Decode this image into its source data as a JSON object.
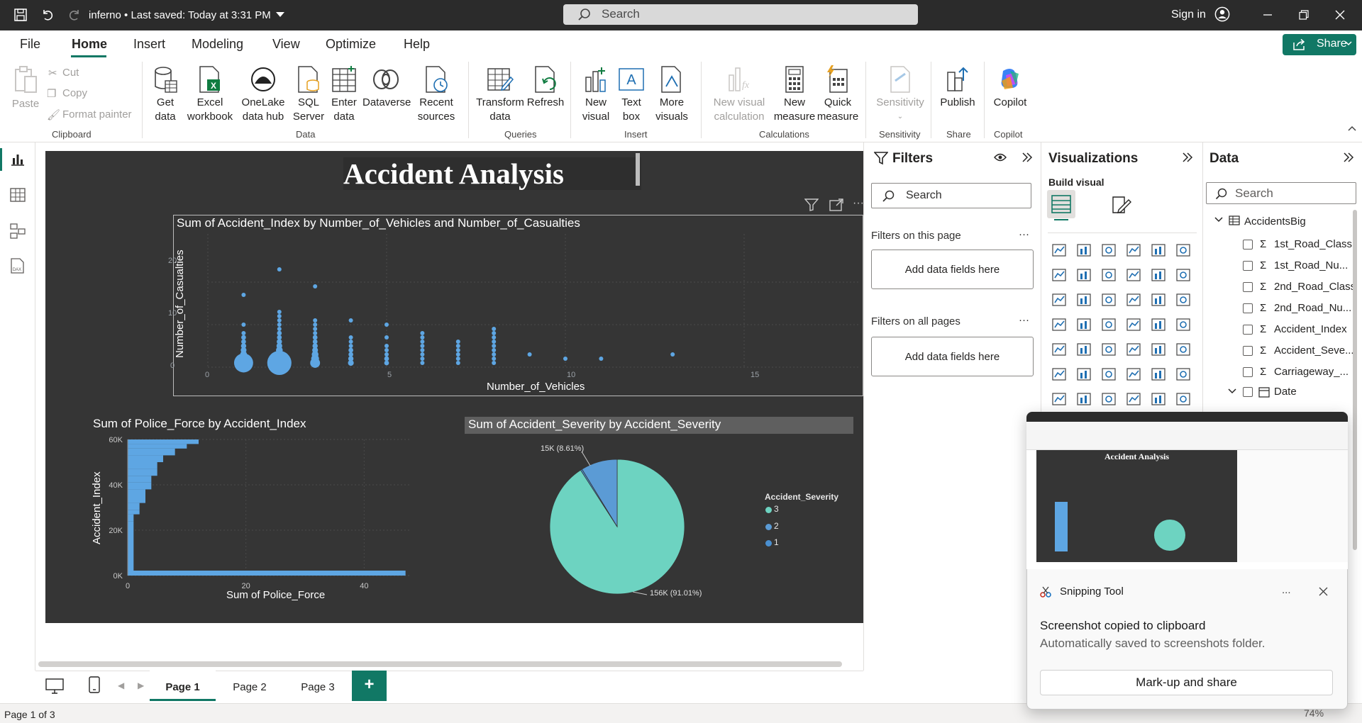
{
  "titlebar": {
    "file_title": "inferno • Last saved: Today at 3:31 PM",
    "search": "Search",
    "sign_in": "Sign in"
  },
  "menu": {
    "items": [
      "File",
      "Home",
      "Insert",
      "Modeling",
      "View",
      "Optimize",
      "Help"
    ],
    "share": "Share"
  },
  "ribbon": {
    "clipboard": {
      "paste": "Paste",
      "cut": "Cut",
      "copy": "Copy",
      "format_painter": "Format painter",
      "group": "Clipboard"
    },
    "data": {
      "get_data": [
        "Get",
        "data"
      ],
      "excel": [
        "Excel",
        "workbook"
      ],
      "onelake": [
        "OneLake",
        "data hub"
      ],
      "sql": [
        "SQL",
        "Server"
      ],
      "enter": [
        "Enter",
        "data"
      ],
      "dataverse": "Dataverse",
      "recent": [
        "Recent",
        "sources"
      ],
      "group": "Data"
    },
    "queries": {
      "transform": [
        "Transform",
        "data"
      ],
      "refresh": "Refresh",
      "group": "Queries"
    },
    "insert": {
      "new_visual": [
        "New",
        "visual"
      ],
      "text_box": [
        "Text",
        "box"
      ],
      "more_visuals": [
        "More",
        "visuals"
      ],
      "group": "Insert"
    },
    "calculations": {
      "new_visual_calc": [
        "New visual",
        "calculation"
      ],
      "new_measure": [
        "New",
        "measure"
      ],
      "quick_measure": [
        "Quick",
        "measure"
      ],
      "group": "Calculations"
    },
    "sensitivity": {
      "label": "Sensitivity",
      "group": "Sensitivity"
    },
    "share": {
      "publish": "Publish",
      "group": "Share"
    },
    "copilot": {
      "label": "Copilot",
      "group": "Copilot"
    }
  },
  "report": {
    "title": "Accident Analysis",
    "scatter": {
      "title": "Sum of Accident_Index by Number_of_Vehicles and Number_of_Casualties",
      "xlabel": "Number_of_Vehicles",
      "ylabel": "Number_of_Casualties",
      "xticks": [
        "0",
        "5",
        "10",
        "15"
      ],
      "yticks": [
        "20",
        "10",
        "0"
      ]
    },
    "bar": {
      "title": "Sum of Police_Force by Accident_Index",
      "xlabel": "Sum of Police_Force",
      "ylabel": "Accident_Index",
      "xticks": [
        "0",
        "20",
        "40"
      ],
      "yticks": [
        "60K",
        "40K",
        "20K",
        "0K"
      ]
    },
    "pie": {
      "title": "Sum of Accident_Severity by Accident_Severity",
      "legend_title": "Accident_Severity",
      "legend": [
        "3",
        "2",
        "1"
      ],
      "label_small": "15K (8.61%)",
      "label_big": "156K (91.01%)"
    }
  },
  "chart_data": [
    {
      "type": "scatter",
      "title": "Sum of Accident_Index by Number_of_Vehicles and Number_of_Casualties",
      "xlabel": "Number_of_Vehicles",
      "ylabel": "Number_of_Casualties",
      "xlim": [
        0,
        18
      ],
      "ylim": [
        0,
        23
      ],
      "points": [
        {
          "x": 1,
          "y": 1,
          "size": 3
        },
        {
          "x": 1,
          "y": 2,
          "size": 1
        },
        {
          "x": 1,
          "y": 3,
          "size": 0.6
        },
        {
          "x": 1,
          "y": 4,
          "size": 0.4
        },
        {
          "x": 1,
          "y": 5,
          "size": 0.3
        },
        {
          "x": 1,
          "y": 6,
          "size": 0.2
        },
        {
          "x": 1,
          "y": 7,
          "size": 0.2
        },
        {
          "x": 1,
          "y": 8,
          "size": 0.1
        },
        {
          "x": 1,
          "y": 10,
          "size": 0.1
        },
        {
          "x": 1,
          "y": 17,
          "size": 0.1
        },
        {
          "x": 2,
          "y": 1,
          "size": 4
        },
        {
          "x": 2,
          "y": 2,
          "size": 2
        },
        {
          "x": 2,
          "y": 3,
          "size": 1
        },
        {
          "x": 2,
          "y": 4,
          "size": 0.6
        },
        {
          "x": 2,
          "y": 5,
          "size": 0.4
        },
        {
          "x": 2,
          "y": 6,
          "size": 0.3
        },
        {
          "x": 2,
          "y": 7,
          "size": 0.2
        },
        {
          "x": 2,
          "y": 8,
          "size": 0.2
        },
        {
          "x": 2,
          "y": 9,
          "size": 0.1
        },
        {
          "x": 2,
          "y": 10,
          "size": 0.1
        },
        {
          "x": 2,
          "y": 11,
          "size": 0.1
        },
        {
          "x": 2,
          "y": 12,
          "size": 0.1
        },
        {
          "x": 2,
          "y": 13,
          "size": 0.1
        },
        {
          "x": 2,
          "y": 23,
          "size": 0.1
        },
        {
          "x": 3,
          "y": 1,
          "size": 1.2
        },
        {
          "x": 3,
          "y": 2,
          "size": 0.8
        },
        {
          "x": 3,
          "y": 3,
          "size": 0.6
        },
        {
          "x": 3,
          "y": 4,
          "size": 0.4
        },
        {
          "x": 3,
          "y": 5,
          "size": 0.3
        },
        {
          "x": 3,
          "y": 6,
          "size": 0.2
        },
        {
          "x": 3,
          "y": 7,
          "size": 0.2
        },
        {
          "x": 3,
          "y": 8,
          "size": 0.1
        },
        {
          "x": 3,
          "y": 9,
          "size": 0.1
        },
        {
          "x": 3,
          "y": 10,
          "size": 0.1
        },
        {
          "x": 3,
          "y": 11,
          "size": 0.1
        },
        {
          "x": 3,
          "y": 19,
          "size": 0.1
        },
        {
          "x": 4,
          "y": 1,
          "size": 0.4
        },
        {
          "x": 4,
          "y": 2,
          "size": 0.3
        },
        {
          "x": 4,
          "y": 3,
          "size": 0.2
        },
        {
          "x": 4,
          "y": 4,
          "size": 0.2
        },
        {
          "x": 4,
          "y": 5,
          "size": 0.1
        },
        {
          "x": 4,
          "y": 6,
          "size": 0.1
        },
        {
          "x": 4,
          "y": 7,
          "size": 0.1
        },
        {
          "x": 4,
          "y": 11,
          "size": 0.1
        },
        {
          "x": 5,
          "y": 1,
          "size": 0.2
        },
        {
          "x": 5,
          "y": 2,
          "size": 0.2
        },
        {
          "x": 5,
          "y": 3,
          "size": 0.1
        },
        {
          "x": 5,
          "y": 4,
          "size": 0.1
        },
        {
          "x": 5,
          "y": 5,
          "size": 0.1
        },
        {
          "x": 5,
          "y": 7,
          "size": 0.1
        },
        {
          "x": 5,
          "y": 10,
          "size": 0.1
        },
        {
          "x": 6,
          "y": 1,
          "size": 0.1
        },
        {
          "x": 6,
          "y": 2,
          "size": 0.1
        },
        {
          "x": 6,
          "y": 3,
          "size": 0.1
        },
        {
          "x": 6,
          "y": 4,
          "size": 0.1
        },
        {
          "x": 6,
          "y": 5,
          "size": 0.1
        },
        {
          "x": 6,
          "y": 6,
          "size": 0.1
        },
        {
          "x": 6,
          "y": 7,
          "size": 0.1
        },
        {
          "x": 6,
          "y": 8,
          "size": 0.1
        },
        {
          "x": 7,
          "y": 1,
          "size": 0.1
        },
        {
          "x": 7,
          "y": 2,
          "size": 0.1
        },
        {
          "x": 7,
          "y": 3,
          "size": 0.1
        },
        {
          "x": 7,
          "y": 4,
          "size": 0.1
        },
        {
          "x": 7,
          "y": 5,
          "size": 0.1
        },
        {
          "x": 7,
          "y": 6,
          "size": 0.1
        },
        {
          "x": 8,
          "y": 1,
          "size": 0.1
        },
        {
          "x": 8,
          "y": 2,
          "size": 0.1
        },
        {
          "x": 8,
          "y": 3,
          "size": 0.1
        },
        {
          "x": 8,
          "y": 4,
          "size": 0.1
        },
        {
          "x": 8,
          "y": 5,
          "size": 0.1
        },
        {
          "x": 8,
          "y": 6,
          "size": 0.1
        },
        {
          "x": 8,
          "y": 7,
          "size": 0.1
        },
        {
          "x": 8,
          "y": 8,
          "size": 0.1
        },
        {
          "x": 8,
          "y": 9,
          "size": 0.1
        },
        {
          "x": 9,
          "y": 3,
          "size": 0.1
        },
        {
          "x": 10,
          "y": 2,
          "size": 0.1
        },
        {
          "x": 11,
          "y": 2,
          "size": 0.1
        },
        {
          "x": 13,
          "y": 3,
          "size": 0.1
        }
      ]
    },
    {
      "type": "bar",
      "orientation": "horizontal",
      "title": "Sum of Police_Force by Accident_Index",
      "xlabel": "Sum of Police_Force",
      "ylabel": "Accident_Index",
      "xlim": [
        0,
        48
      ],
      "ylim": [
        0,
        60000
      ],
      "steps": [
        {
          "y": 60000,
          "x": 12
        },
        {
          "y": 58000,
          "x": 10
        },
        {
          "y": 56000,
          "x": 8
        },
        {
          "y": 53000,
          "x": 6
        },
        {
          "y": 50000,
          "x": 5
        },
        {
          "y": 47000,
          "x": 5
        },
        {
          "y": 44000,
          "x": 4
        },
        {
          "y": 41000,
          "x": 4
        },
        {
          "y": 38000,
          "x": 3
        },
        {
          "y": 35000,
          "x": 3
        },
        {
          "y": 32000,
          "x": 2
        },
        {
          "y": 29000,
          "x": 2
        },
        {
          "y": 27000,
          "x": 1
        },
        {
          "y": 24000,
          "x": 1
        },
        {
          "y": 20000,
          "x": 1
        },
        {
          "y": 15000,
          "x": 1
        },
        {
          "y": 10000,
          "x": 1
        },
        {
          "y": 5000,
          "x": 1
        },
        {
          "y": 500,
          "x": 47
        }
      ]
    },
    {
      "type": "pie",
      "title": "Sum of Accident_Severity by Accident_Severity",
      "legend_title": "Accident_Severity",
      "slices": [
        {
          "name": "3",
          "value": 156000,
          "percent": 91.01,
          "label": "156K (91.01%)",
          "color": "#6dd3c1"
        },
        {
          "name": "2",
          "value": 15000,
          "percent": 8.61,
          "label": "15K (8.61%)",
          "color": "#5b9bd5"
        },
        {
          "name": "1",
          "value": 650,
          "percent": 0.38,
          "label": "",
          "color": "#4a8fd0"
        }
      ]
    }
  ],
  "filters": {
    "title": "Filters",
    "search": "Search",
    "on_page": "Filters on this page",
    "on_all": "Filters on all pages",
    "add_fields": "Add data fields here"
  },
  "visualizations": {
    "title": "Visualizations",
    "build": "Build visual"
  },
  "data_pane": {
    "title": "Data",
    "search": "Search",
    "table": "AccidentsBig",
    "fields": [
      "1st_Road_Class",
      "1st_Road_Nu...",
      "2nd_Road_Class",
      "2nd_Road_Nu...",
      "Accident_Index",
      "Accident_Seve...",
      "Carriageway_..."
    ],
    "date": "Date"
  },
  "pages": {
    "tabs": [
      "Page 1",
      "Page 2",
      "Page 3"
    ],
    "add": "+",
    "status": "Page 1 of 3",
    "zoom": "74%"
  },
  "snipping": {
    "app": "Snipping Tool",
    "more": "...",
    "headline": "Screenshot copied to clipboard",
    "sub": "Automatically saved to screenshots folder.",
    "button": "Mark-up and share"
  },
  "colors": {
    "accent": "#117865",
    "report_bg": "#353535",
    "bar_blue": "#5ea6e3",
    "teal": "#6dd3c1"
  }
}
